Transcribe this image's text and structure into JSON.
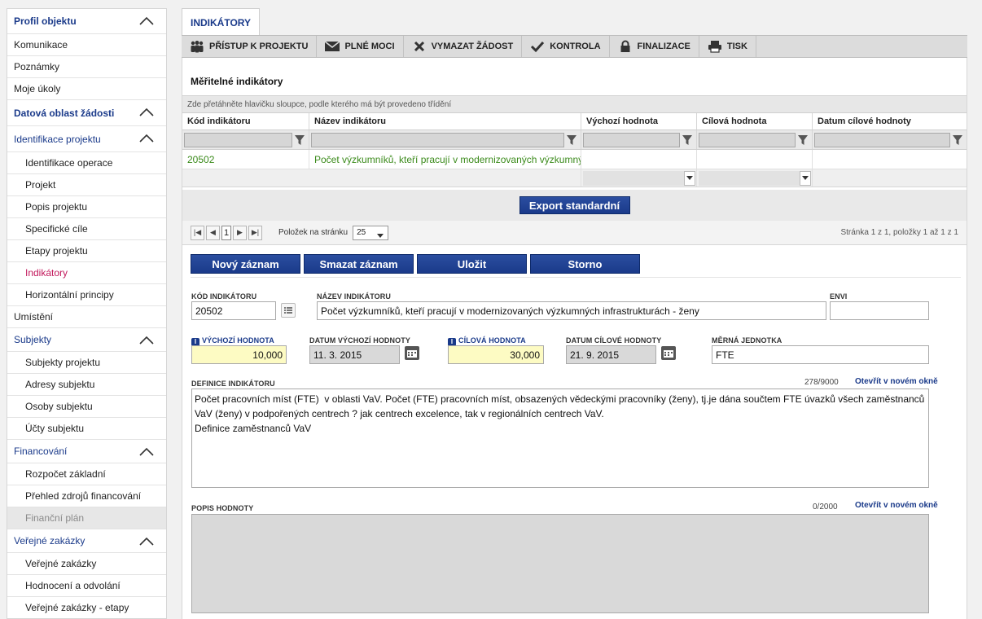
{
  "sidebar": {
    "profile": "Profil objektu",
    "items": [
      {
        "label": "Komunikace"
      },
      {
        "label": "Poznámky"
      },
      {
        "label": "Moje úkoly"
      }
    ],
    "data_section": "Datová oblast žádosti",
    "groups": [
      {
        "label": "Identifikace projektu",
        "items": [
          "Identifikace operace",
          "Projekt",
          "Popis projektu",
          "Specifické cíle",
          "Etapy projektu",
          "Indikátory",
          "Horizontální principy"
        ]
      }
    ],
    "umisteni": "Umístění",
    "subjekty": {
      "label": "Subjekty",
      "items": [
        "Subjekty projektu",
        "Adresy subjektu",
        "Osoby subjektu",
        "Účty subjektu"
      ]
    },
    "financovani": {
      "label": "Financování",
      "items": [
        "Rozpočet základní",
        "Přehled zdrojů financování",
        "Finanční plán"
      ]
    },
    "zakazky": {
      "label": "Veřejné zakázky",
      "items": [
        "Veřejné zakázky",
        "Hodnocení a odvolání",
        "Veřejné zakázky - etapy"
      ]
    }
  },
  "tab": {
    "label": "INDIKÁTORY"
  },
  "toolbar": {
    "access": "PŘÍSTUP K PROJEKTU",
    "powers": "PLNÉ MOCI",
    "delete": "VYMAZAT ŽÁDOST",
    "check": "KONTROLA",
    "finalize": "FINALIZACE",
    "print": "TISK"
  },
  "section_title": "Měřitelné indikátory",
  "grid": {
    "hint": "Zde přetáhněte hlavičku sloupce, podle kterého má být provedeno třídění",
    "columns": [
      "Kód indikátoru",
      "Název indikátoru",
      "Výchozí hodnota",
      "Cílová hodnota",
      "Datum cílové hodnoty"
    ],
    "rows": [
      {
        "code": "20502",
        "name": "Počet výzkumníků, kteří pracují v modernizovaných výzkumný…",
        "start": "",
        "target": "",
        "date": ""
      }
    ]
  },
  "export_label": "Export standardní",
  "pager": {
    "page": "1",
    "per_page_label": "Položek na stránku",
    "per_page": "25",
    "info": "Stránka 1 z 1, položky 1 až 1 z 1"
  },
  "actions": {
    "new": "Nový záznam",
    "delete": "Smazat záznam",
    "save": "Uložit",
    "cancel": "Storno"
  },
  "form": {
    "code_label": "KÓD INDIKÁTORU",
    "code_value": "20502",
    "name_label": "NÁZEV INDIKÁTORU",
    "name_value": "Počet výzkumníků, kteří pracují v modernizovaných výzkumných infrastrukturách - ženy",
    "envi_label": "ENVI",
    "envi_value": "",
    "start_label": "VÝCHOZÍ HODNOTA",
    "start_value": "10,000",
    "start_date_label": "DATUM VÝCHOZÍ HODNOTY",
    "start_date_value": "11. 3. 2015",
    "target_label": "CÍLOVÁ HODNOTA",
    "target_value": "30,000",
    "target_date_label": "DATUM CÍLOVÉ HODNOTY",
    "target_date_value": "21. 9. 2015",
    "unit_label": "MĚRNÁ JEDNOTKA",
    "unit_value": "FTE",
    "definition_label": "DEFINICE INDIKÁTORU",
    "definition_counter": "278/9000",
    "definition_link": "Otevřít v novém okně",
    "definition_text": "Počet pracovních míst (FTE)  v oblasti VaV. Počet (FTE) pracovních míst, obsazených vědeckými pracovníky (ženy), tj.je dána součtem FTE úvazků všech zaměstnanců VaV (ženy) v podpořených centrech ? jak centrech excelence, tak v regionálních centrech VaV.\nDefinice zaměstnanců VaV",
    "desc_label": "POPIS HODNOTY",
    "desc_counter": "0/2000",
    "desc_link": "Otevřít v novém okně"
  },
  "colors": {
    "accent": "#1a3a8a",
    "active": "#c2185b",
    "link_green": "#3a8a1a",
    "required_bg": "#fdfbc3"
  }
}
